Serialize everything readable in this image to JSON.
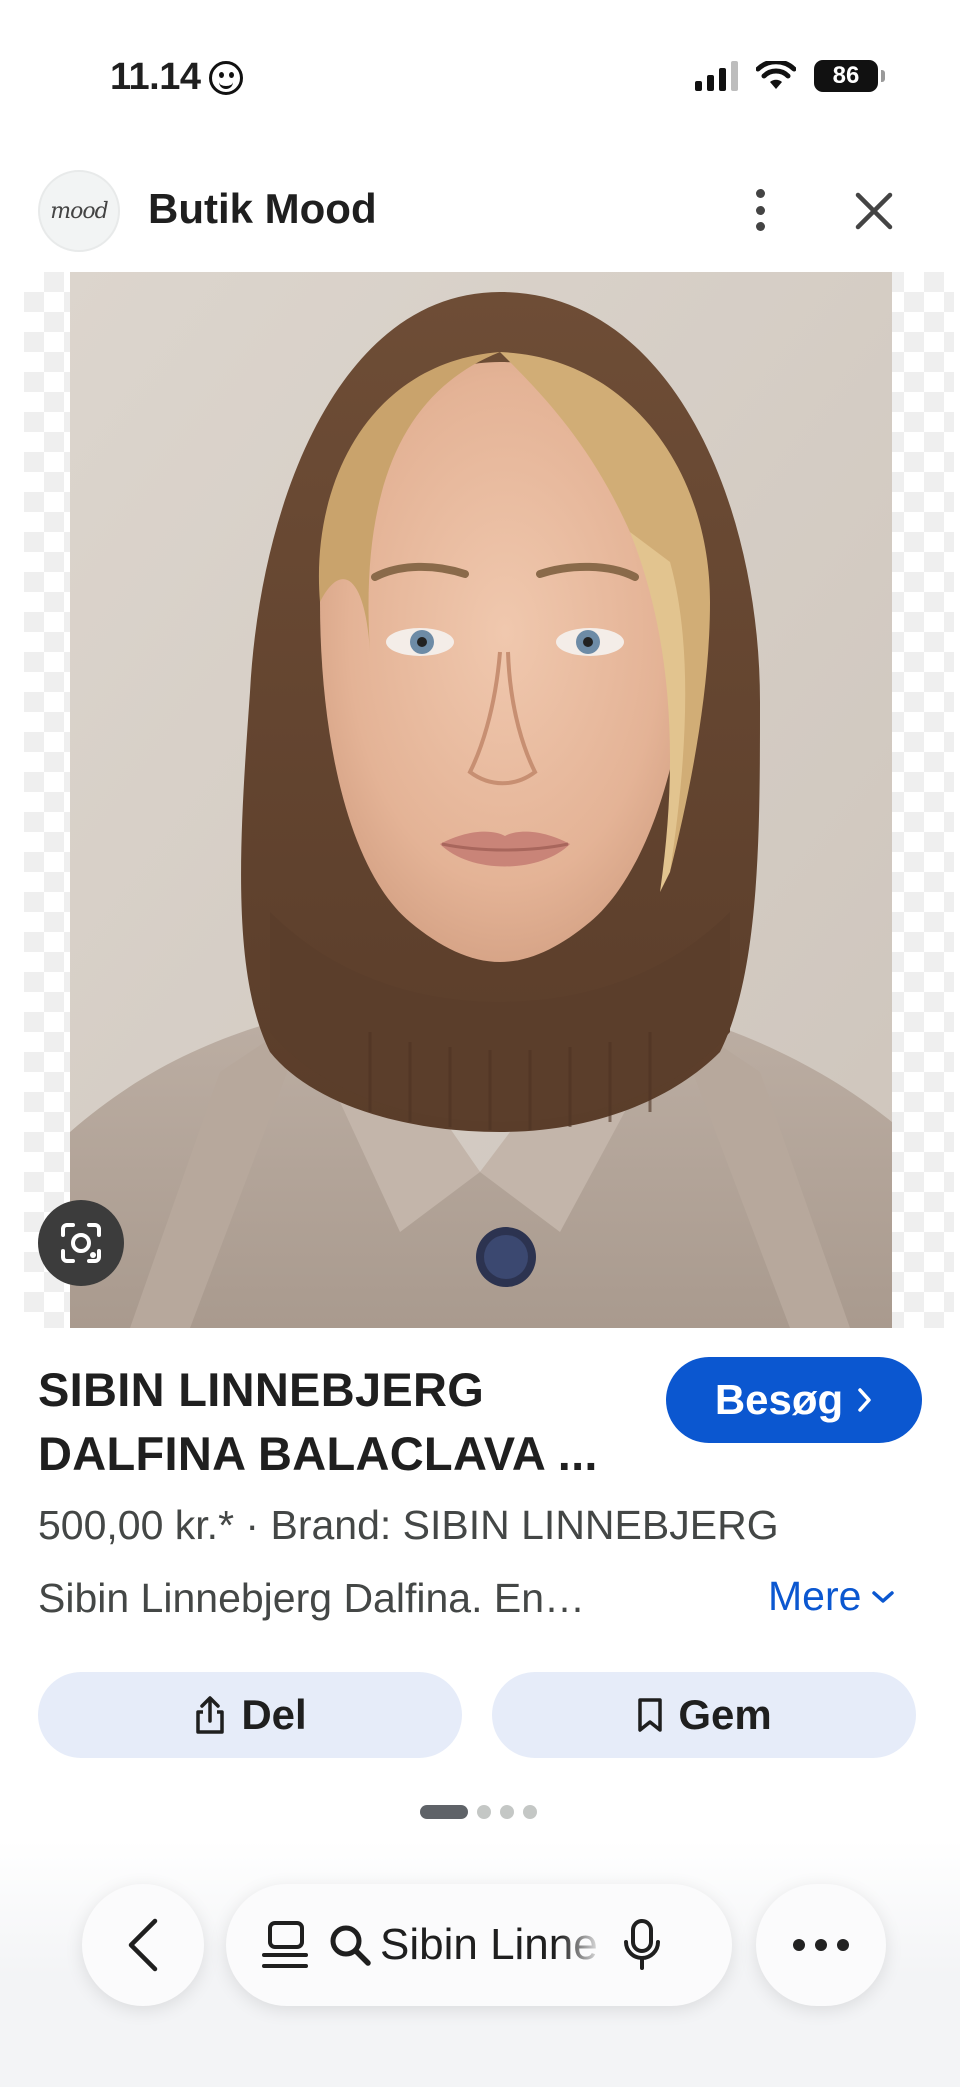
{
  "status_bar": {
    "time": "11.14",
    "battery": "86"
  },
  "header": {
    "site_logo_text": "mood",
    "site_name": "Butik Mood"
  },
  "product": {
    "title": "SIBIN LINNEBJERG DALFINA BALACLAVA ...",
    "visit_label": "Besøg",
    "price_line": "500,00 kr.* · Brand: SIBIN LINNEBJERG",
    "description": "Sibin Linnebjerg Dalfina. En…",
    "more_label": "Mere"
  },
  "actions": {
    "share_label": "Del",
    "save_label": "Gem"
  },
  "pagination": {
    "current": 1,
    "total": 4
  },
  "bottom_bar": {
    "search_query": "Sibin Linne"
  },
  "colors": {
    "accent": "#0b57d0",
    "action_bg": "#e6ecf9",
    "balaclava": "#6b4a32",
    "coat": "#b3a59a"
  },
  "icons": [
    "smiley-icon",
    "signal-icon",
    "wifi-icon",
    "battery-icon",
    "more-vert-icon",
    "close-icon",
    "lens-icon",
    "chevron-right-icon",
    "chevron-down-icon",
    "share-icon",
    "bookmark-icon",
    "back-arrow-icon",
    "tabs-icon",
    "search-icon",
    "mic-icon",
    "more-horiz-icon"
  ]
}
